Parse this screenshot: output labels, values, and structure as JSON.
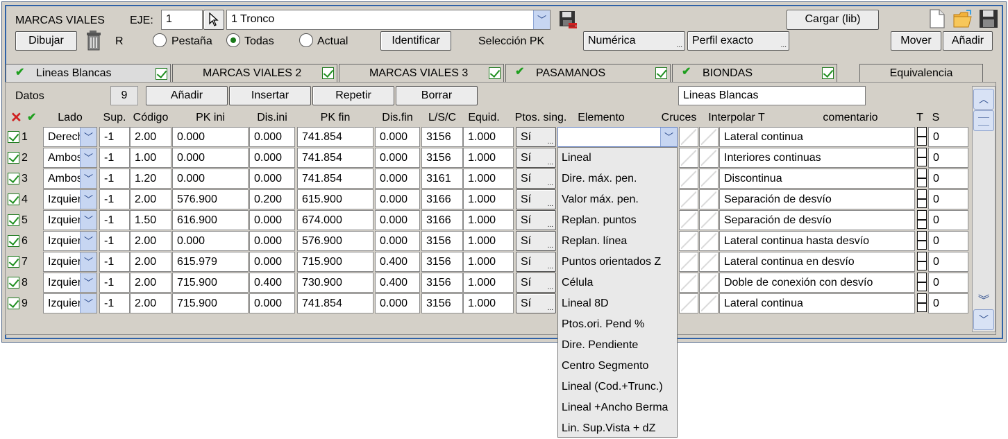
{
  "toolbar": {
    "title": "MARCAS VIALES",
    "eje_label": "EJE:",
    "eje_value": "1",
    "tronco_value": "1 Tronco",
    "cargar_label": "Cargar (lib)",
    "dibujar_label": "Dibujar",
    "r_label": "R",
    "radio_pestana": "Pestaña",
    "radio_todas": "Todas",
    "radio_actual": "Actual",
    "selected_radio": "Todas",
    "identificar_label": "Identificar",
    "seleccion_pk_label": "Selección PK",
    "numerica_label": "Numérica",
    "perfil_label": "Perfil exacto",
    "mover_label": "Mover",
    "anadir_label": "Añadir"
  },
  "tabs": [
    {
      "label": "Lineas Blancas",
      "active": true,
      "checked": true
    },
    {
      "label": "MARCAS VIALES 2",
      "active": false,
      "checked": false
    },
    {
      "label": "MARCAS VIALES 3",
      "active": false,
      "checked": false
    },
    {
      "label": "PASAMANOS",
      "active": false,
      "checked": true
    },
    {
      "label": "BIONDAS",
      "active": false,
      "checked": true
    },
    {
      "label": "Equivalencia",
      "active": false,
      "checked": false
    }
  ],
  "data_bar": {
    "datos_label": "Datos",
    "count": "9",
    "anadir": "Añadir",
    "insertar": "Insertar",
    "repetir": "Repetir",
    "borrar": "Borrar",
    "name_value": "Lineas Blancas"
  },
  "columns": [
    "Lado",
    "Sup.",
    "Código",
    "PK ini",
    "Dis.ini",
    "PK fin",
    "Dis.fin",
    "L/S/C",
    "Equid.",
    "Ptos. sing.",
    "Elemento",
    "Cruces",
    "Interpolar T",
    "comentario",
    "T",
    "S"
  ],
  "rows": [
    {
      "n": "1",
      "lado": "Derecha",
      "sup": "-1",
      "codigo": "2.00",
      "pkini": "0.000",
      "disini": "0.000",
      "pkfin": "741.854",
      "disfin": "0.000",
      "lsc": "3156",
      "equid": "1.000",
      "ptos": "Sí",
      "coment": "Lateral continua",
      "s": "0"
    },
    {
      "n": "2",
      "lado": "Ambos",
      "sup": "-1",
      "codigo": "1.00",
      "pkini": "0.000",
      "disini": "0.000",
      "pkfin": "741.854",
      "disfin": "0.000",
      "lsc": "3156",
      "equid": "1.000",
      "ptos": "Sí",
      "coment": "Interiores continuas",
      "s": "0"
    },
    {
      "n": "3",
      "lado": "Ambos",
      "sup": "-1",
      "codigo": "1.20",
      "pkini": "0.000",
      "disini": "0.000",
      "pkfin": "741.854",
      "disfin": "0.000",
      "lsc": "3161",
      "equid": "1.000",
      "ptos": "Sí",
      "coment": "Discontinua",
      "s": "0"
    },
    {
      "n": "4",
      "lado": "Izquierda",
      "sup": "-1",
      "codigo": "2.00",
      "pkini": "576.900",
      "disini": "0.200",
      "pkfin": "615.900",
      "disfin": "0.000",
      "lsc": "3166",
      "equid": "1.000",
      "ptos": "Sí",
      "coment": "Separación de desvío",
      "s": "0"
    },
    {
      "n": "5",
      "lado": "Izquierda",
      "sup": "-1",
      "codigo": "1.50",
      "pkini": "616.900",
      "disini": "0.000",
      "pkfin": "674.000",
      "disfin": "0.000",
      "lsc": "3166",
      "equid": "1.000",
      "ptos": "Sí",
      "coment": "Separación de desvío",
      "s": "0"
    },
    {
      "n": "6",
      "lado": "Izquierda",
      "sup": "-1",
      "codigo": "2.00",
      "pkini": "0.000",
      "disini": "0.000",
      "pkfin": "576.900",
      "disfin": "0.000",
      "lsc": "3156",
      "equid": "1.000",
      "ptos": "Sí",
      "coment": "Lateral continua hasta desvío",
      "s": "0"
    },
    {
      "n": "7",
      "lado": "Izquierda",
      "sup": "-1",
      "codigo": "2.00",
      "pkini": "615.979",
      "disini": "0.000",
      "pkfin": "715.900",
      "disfin": "0.400",
      "lsc": "3156",
      "equid": "1.000",
      "ptos": "Sí",
      "coment": "Lateral continua en desvío",
      "s": "0"
    },
    {
      "n": "8",
      "lado": "Izquierda",
      "sup": "-1",
      "codigo": "2.00",
      "pkini": "715.900",
      "disini": "0.400",
      "pkfin": "730.900",
      "disfin": "0.400",
      "lsc": "3156",
      "equid": "1.000",
      "ptos": "Sí",
      "coment": "Doble de conexión con desvío",
      "s": "0"
    },
    {
      "n": "9",
      "lado": "Izquierda",
      "sup": "-1",
      "codigo": "2.00",
      "pkini": "715.900",
      "disini": "0.000",
      "pkfin": "741.854",
      "disfin": "0.000",
      "lsc": "3156",
      "equid": "1.000",
      "ptos": "Sí",
      "coment": "Lateral continua",
      "s": "0"
    }
  ],
  "elemento_options": [
    "Lineal",
    "Dire. máx. pen.",
    "Valor máx. pen.",
    "Replan. puntos",
    "Replan. línea",
    "Puntos orientados Z",
    "Célula",
    "Lineal 8D",
    "Ptos.ori. Pend %",
    "Dire. Pendiente",
    "Centro Segmento",
    "Lineal (Cod.+Trunc.)",
    "Lineal +Ancho Berma",
    "Lin. Sup.Vista + dZ"
  ],
  "elemento_selected": "",
  "colors": {
    "frame": "#2f62a8",
    "combo_button": "#c7d6f2",
    "check_green": "#1f8f1f",
    "delete_red": "#d02020"
  }
}
